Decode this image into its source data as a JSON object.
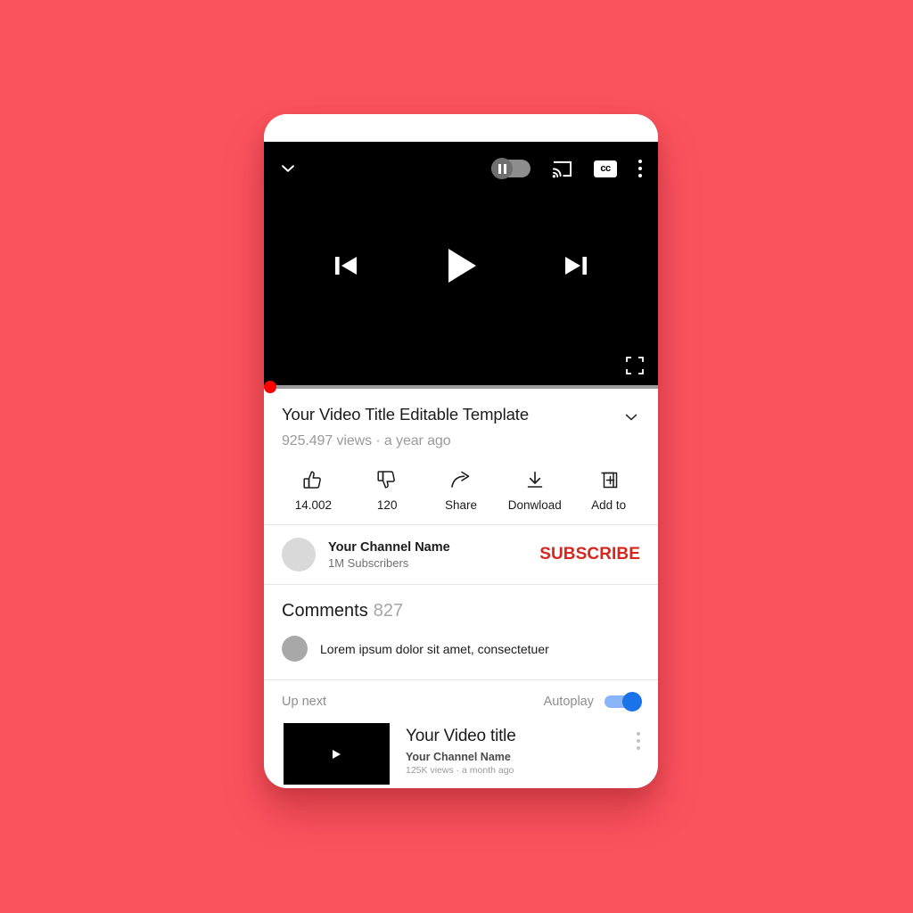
{
  "background": {
    "color": "#fb535e"
  },
  "player": {
    "topbar": {
      "collapse_icon": "chevron-down-icon",
      "quality_toggle": {
        "icon": "pause-toggle-icon",
        "state": "on"
      },
      "cast_icon": "cast-icon",
      "cc_label": "cc",
      "more_icon": "more-vertical-icon"
    },
    "controls": {
      "previous_icon": "skip-previous-icon",
      "play_icon": "play-icon",
      "next_icon": "skip-next-icon"
    },
    "fullscreen_icon": "fullscreen-icon",
    "progress": {
      "played_percent": 0,
      "bar_color": "#9b9b9b",
      "played_color": "#ff0000",
      "knob_color": "#ff0000"
    }
  },
  "video": {
    "title": "Your Video Title Editable Template",
    "expand_icon": "chevron-down-icon",
    "stats": "925.497 views · a year ago",
    "actions": [
      {
        "icon": "thumbs-up-icon",
        "label": "14.002",
        "name": "like"
      },
      {
        "icon": "thumbs-down-icon",
        "label": "120",
        "name": "dislike"
      },
      {
        "icon": "share-icon",
        "label": "Share",
        "name": "share"
      },
      {
        "icon": "download-icon",
        "label": "Donwload",
        "name": "download"
      },
      {
        "icon": "add-to-icon",
        "label": "Add to",
        "name": "add-to"
      }
    ]
  },
  "channel": {
    "avatar_icon": "channel-avatar",
    "name": "Your Channel Name",
    "subscribers": "1M Subscribers",
    "subscribe_label": "SUBSCRIBE",
    "subscribe_color": "#d7261e"
  },
  "comments": {
    "heading": "Comments",
    "count": "827",
    "first_comment": {
      "avatar_icon": "comment-avatar",
      "text": "Lorem ipsum dolor sit amet, consectetuer"
    }
  },
  "up_next": {
    "label": "Up next",
    "autoplay_label": "Autoplay",
    "autoplay_on": true,
    "autoplay_color": "#1a73e8",
    "item": {
      "thumbnail_icon": "video-thumbnail-play-icon",
      "title": "Your Video title",
      "channel": "Your Channel Name",
      "meta": "125K views · a month ago",
      "menu_icon": "more-vertical-icon"
    }
  }
}
